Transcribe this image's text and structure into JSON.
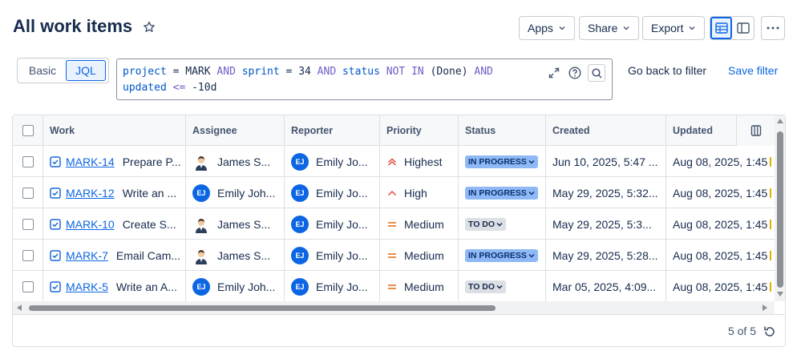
{
  "header": {
    "title": "All work items",
    "buttons": {
      "apps": "Apps",
      "share": "Share",
      "export": "Export"
    }
  },
  "search": {
    "modes": {
      "basic": "Basic",
      "jql": "JQL"
    },
    "query": {
      "t1": "project",
      "t2": " = ",
      "t3": "MARK",
      "t4": " AND ",
      "t5": "sprint",
      "t6": " = ",
      "t7": "34",
      "t8": " AND ",
      "t9": "status",
      "t10": " NOT IN ",
      "t11": "(Done)",
      "t12": " AND",
      "t13": "updated",
      "t14": " <= ",
      "t15": "-10d"
    },
    "go_back": "Go back to filter",
    "save": "Save filter"
  },
  "table": {
    "columns": {
      "work": "Work",
      "assignee": "Assignee",
      "reporter": "Reporter",
      "priority": "Priority",
      "status": "Status",
      "created": "Created",
      "updated": "Updated"
    },
    "rows": [
      {
        "key": "MARK-14",
        "summary": "Prepare P...",
        "assignee": "James S...",
        "assignee_avatar": "person",
        "reporter": "Emily Jo...",
        "priority": "Highest",
        "status": "IN PROGRESS",
        "created": "Jun 10, 2025, 5:47 ...",
        "updated": "Aug 08, 2025, 1:45"
      },
      {
        "key": "MARK-12",
        "summary": "Write an ...",
        "assignee": "Emily Joh...",
        "assignee_avatar": "EJ",
        "reporter": "Emily Jo...",
        "priority": "High",
        "status": "IN PROGRESS",
        "created": "May 29, 2025, 5:32...",
        "updated": "Aug 08, 2025, 1:45"
      },
      {
        "key": "MARK-10",
        "summary": "Create S...",
        "assignee": "James S...",
        "assignee_avatar": "person",
        "reporter": "Emily Jo...",
        "priority": "Medium",
        "status": "TO DO",
        "created": "May 29, 2025, 5:3...",
        "updated": "Aug 08, 2025, 1:45"
      },
      {
        "key": "MARK-7",
        "summary": "Email Cam...",
        "assignee": "James S...",
        "assignee_avatar": "person",
        "reporter": "Emily Jo...",
        "priority": "Medium",
        "status": "IN PROGRESS",
        "created": "May 29, 2025, 5:28...",
        "updated": "Aug 08, 2025, 1:45"
      },
      {
        "key": "MARK-5",
        "summary": "Write an A...",
        "assignee": "Emily Joh...",
        "assignee_avatar": "EJ",
        "reporter": "Emily Jo...",
        "priority": "Medium",
        "status": "TO DO",
        "created": "Mar 05, 2025, 4:09...",
        "updated": "Aug 08, 2025, 1:45"
      }
    ],
    "reporter_initials": "EJ",
    "count": "5 of 5"
  },
  "colors": {
    "accent": "#0c66e4",
    "in_progress": "#8fb8f6",
    "to_do": "#dcdfe4",
    "highest": "#e2483d",
    "medium": "#e56910"
  }
}
